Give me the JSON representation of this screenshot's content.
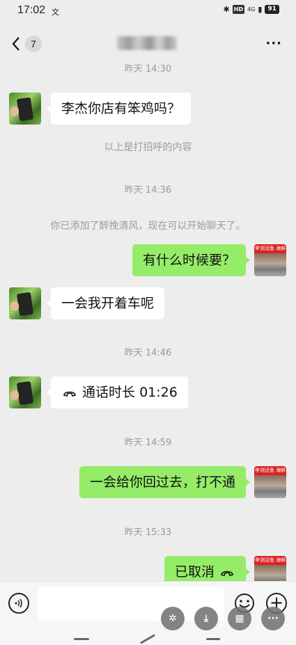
{
  "status_bar": {
    "time": "17:02",
    "notification_glyph": "文",
    "hd_label": "HD",
    "network": "4G",
    "battery": "91"
  },
  "nav": {
    "back_count": "7",
    "more_label": "···"
  },
  "messages": [
    {
      "kind": "timestamp",
      "text": "昨天 14:30"
    },
    {
      "kind": "in",
      "text": "李杰你店有笨鸡吗？"
    },
    {
      "kind": "system",
      "text": "以上是打招呼的内容"
    },
    {
      "kind": "timestamp",
      "text": "昨天 14:36"
    },
    {
      "kind": "system",
      "text": "你已添加了醉挽清风，现在可以开始聊天了。"
    },
    {
      "kind": "out",
      "text": "有什么时候要？"
    },
    {
      "kind": "in",
      "text": "一会我开着车呢"
    },
    {
      "kind": "timestamp",
      "text": "昨天 14:46"
    },
    {
      "kind": "in_call",
      "text": "通话时长 01:26"
    },
    {
      "kind": "timestamp",
      "text": "昨天 14:59"
    },
    {
      "kind": "out",
      "text": "一会给你回过去，打不通"
    },
    {
      "kind": "timestamp",
      "text": "昨天 15:33"
    },
    {
      "kind": "out_call",
      "text": "已取消"
    }
  ],
  "right_avatar_sign": "李测活鱼 海鲜",
  "icons": {
    "back": "chevron-left-icon",
    "more": "more-dots-icon",
    "voice": "voice-input-icon",
    "emoji": "emoji-icon",
    "plus": "plus-icon",
    "phone": "phone-icon"
  },
  "colors": {
    "background": "#ededed",
    "outgoing_bubble": "#95ec69",
    "incoming_bubble": "#ffffff",
    "meta_text": "#999999"
  }
}
